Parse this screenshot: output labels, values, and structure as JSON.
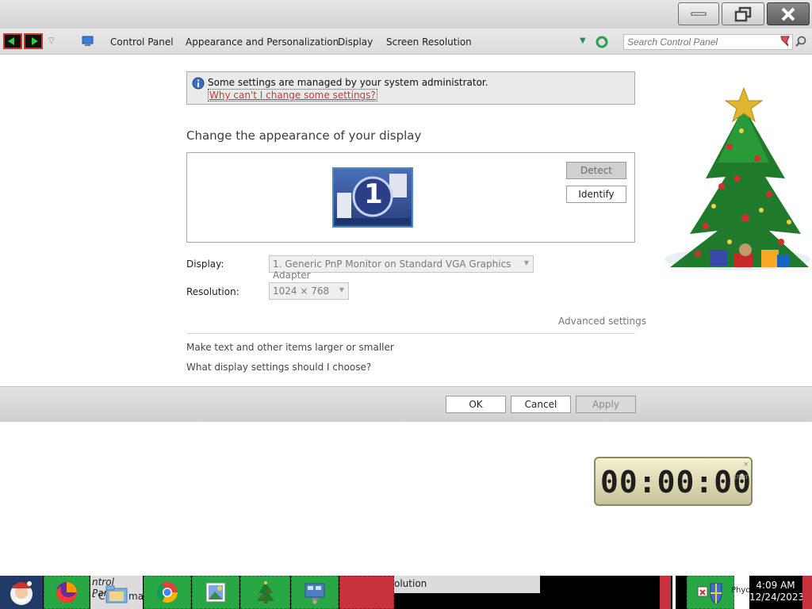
{
  "window": {
    "minimize_label": "—",
    "maximize_label": "❐",
    "close_label": "✕"
  },
  "address": {
    "breadcrumbs": [
      "Control Panel",
      "Appearance and Personalization",
      "Display",
      "Screen Resolution"
    ],
    "search_placeholder": "Search Control Panel"
  },
  "infobar": {
    "message": "Some settings are managed by your system administrator.",
    "link": "Why can't I change some settings?"
  },
  "main": {
    "heading": "Change the appearance of your display",
    "monitor_number": "1",
    "detect_label": "Detect",
    "identify_label": "Identify",
    "display_label": "Display:",
    "display_value": "1. Generic PnP Monitor on Standard VGA Graphics Adapter",
    "resolution_label": "Resolution:",
    "resolution_value": "1024 × 768",
    "advanced_link": "Advanced settings",
    "link_text_size": "Make text and other items larger or smaller",
    "link_help": "What display settings should I choose?"
  },
  "footer": {
    "ok_label": "OK",
    "cancel_label": "Cancel",
    "apply_label": "Apply"
  },
  "timer": {
    "digits": "00:00:00",
    "start_label": "START",
    "close_label": "×"
  },
  "taskbar": {
    "cp_label_1": "ntrol Panel",
    "cp_label_2": "- C",
    "cp_label_3": "mas",
    "res_label": "olution",
    "tray_icon_text": "Phyo",
    "time": "4:09 AM",
    "date": "12/24/2023"
  },
  "colors": {
    "accent_link": "#c23b3b",
    "taskbar_green": "#28a845",
    "taskbar_red": "#c8323c"
  }
}
